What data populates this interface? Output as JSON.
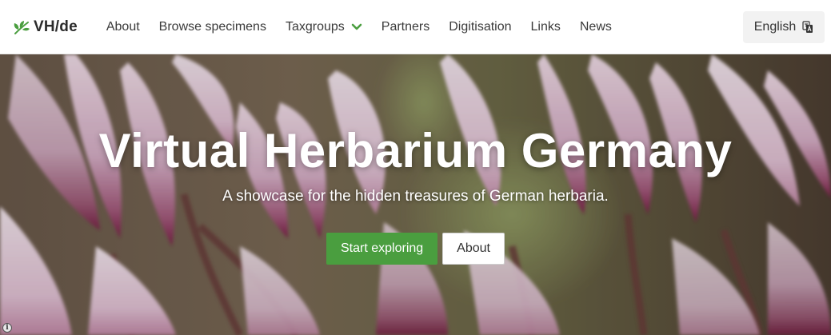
{
  "brand": {
    "name": "VH/de",
    "logo_icon": "leaf-icon",
    "accent": "#4a9e3f"
  },
  "nav": {
    "items": [
      {
        "label": "About"
      },
      {
        "label": "Browse specimens"
      },
      {
        "label": "Taxgroups",
        "icon": "chevron-down-icon"
      },
      {
        "label": "Partners"
      },
      {
        "label": "Digitisation"
      },
      {
        "label": "Links"
      },
      {
        "label": "News"
      }
    ],
    "language": {
      "label": "English",
      "icon": "translate-icon"
    }
  },
  "hero": {
    "title": "Virtual Herbarium Germany",
    "subtitle": "A showcase for the hidden treasures of German herbaria.",
    "primary_button": "Start exploring",
    "secondary_button": "About",
    "info_badge": "i"
  },
  "colors": {
    "primary_button": "#4a9e3f",
    "flower_pink": "#e6c6dc",
    "flower_center": "#8b1e4a"
  }
}
